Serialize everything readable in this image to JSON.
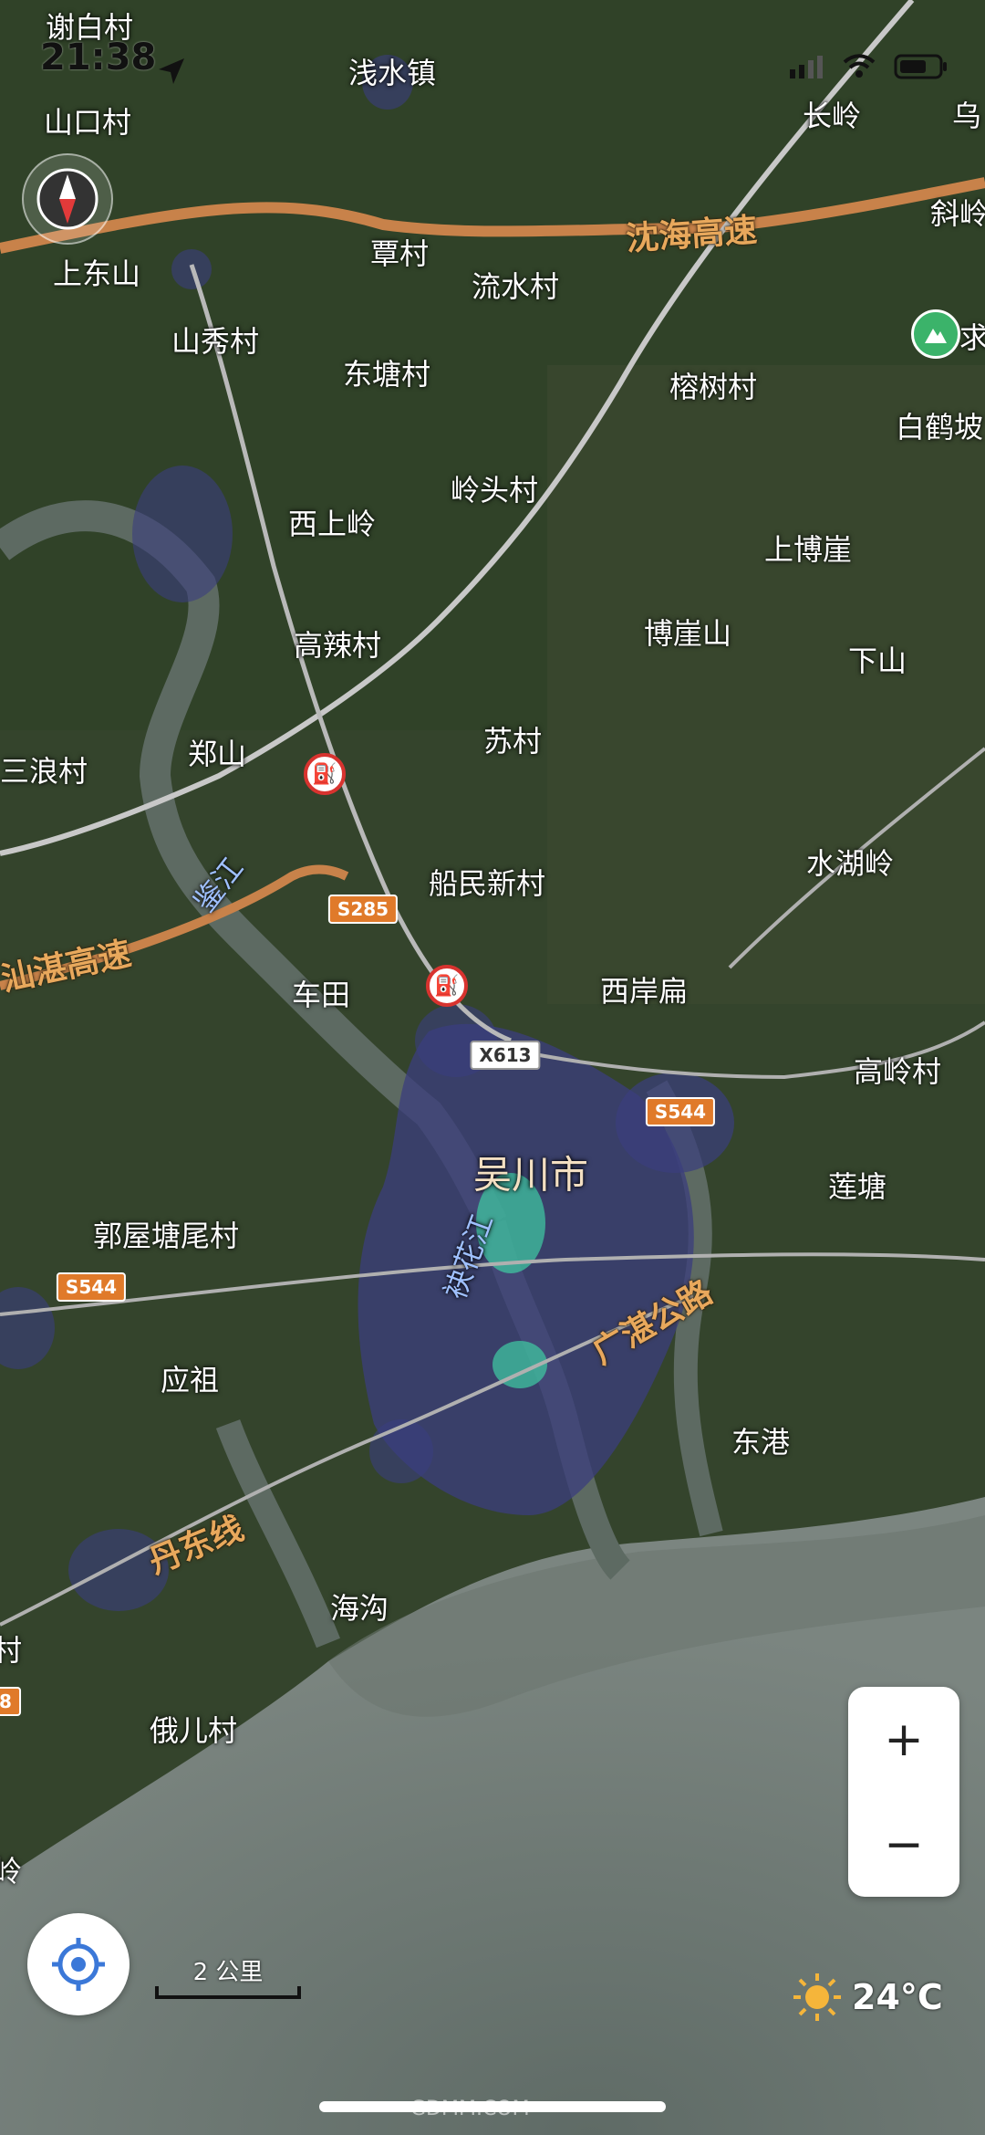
{
  "status_bar": {
    "time": "21:38"
  },
  "map": {
    "city": "吴川市",
    "places": [
      {
        "key": "xiebai",
        "text": "谢白村"
      },
      {
        "key": "qianshui",
        "text": "浅水镇"
      },
      {
        "key": "shankou",
        "text": "山口村"
      },
      {
        "key": "changling",
        "text": "长岭"
      },
      {
        "key": "wuzhu",
        "text": "乌"
      },
      {
        "key": "shangdong",
        "text": "上东山"
      },
      {
        "key": "tancun",
        "text": "覃村"
      },
      {
        "key": "liushui",
        "text": "流水村"
      },
      {
        "key": "xieling",
        "text": "斜岭"
      },
      {
        "key": "shanxiu",
        "text": "山秀村"
      },
      {
        "key": "dongtang",
        "text": "东塘村"
      },
      {
        "key": "rongshu",
        "text": "榕树村"
      },
      {
        "key": "qiu",
        "text": "求"
      },
      {
        "key": "baihepo",
        "text": "白鹤坡"
      },
      {
        "key": "lingtou",
        "text": "岭头村"
      },
      {
        "key": "xishang",
        "text": "西上岭"
      },
      {
        "key": "shangboya",
        "text": "上博崖"
      },
      {
        "key": "gaola",
        "text": "高辣村"
      },
      {
        "key": "boyashan",
        "text": "博崖山"
      },
      {
        "key": "xiashan",
        "text": "下山"
      },
      {
        "key": "sancun",
        "text": "苏村"
      },
      {
        "key": "sanlang",
        "text": "三浪村"
      },
      {
        "key": "zhengshan",
        "text": "郑山"
      },
      {
        "key": "shuihuling",
        "text": "水湖岭"
      },
      {
        "key": "chuanmin",
        "text": "船民新村"
      },
      {
        "key": "chetian",
        "text": "车田"
      },
      {
        "key": "xianbian",
        "text": "西岸扁"
      },
      {
        "key": "gaoling",
        "text": "高岭村"
      },
      {
        "key": "liantang",
        "text": "莲塘"
      },
      {
        "key": "guowu",
        "text": "郭屋塘尾村"
      },
      {
        "key": "yingzu",
        "text": "应祖"
      },
      {
        "key": "donggang",
        "text": "东港"
      },
      {
        "key": "haigou",
        "text": "海沟"
      },
      {
        "key": "eer",
        "text": "俄儿村"
      },
      {
        "key": "cun_edge",
        "text": "村"
      },
      {
        "key": "ling_edge",
        "text": "岭"
      }
    ],
    "roads": [
      {
        "key": "shenhai",
        "text": "沈海高速"
      },
      {
        "key": "shanzhan",
        "text": "汕湛高速"
      },
      {
        "key": "guangzhan",
        "text": "广湛公路"
      },
      {
        "key": "dandong",
        "text": "丹东线"
      },
      {
        "key": "jianjiang",
        "text": "鉴江"
      },
      {
        "key": "meijiang",
        "text": "袂花江"
      }
    ],
    "shields": {
      "s285": "S285",
      "x613": "X613",
      "s544a": "S544",
      "s544b": "S544",
      "edge8": "8"
    }
  },
  "controls": {
    "zoom_in": "+",
    "zoom_out": "−",
    "scale_label": "2 公里",
    "temperature": "24°C"
  },
  "watermark": "GDMM.COM"
}
